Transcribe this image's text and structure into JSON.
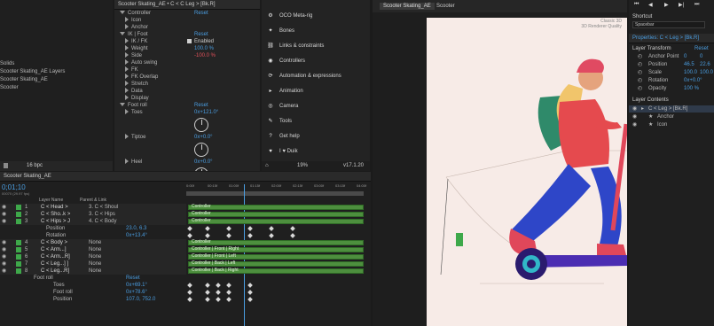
{
  "effect_controls": {
    "title": "Scooter Skating_AE • C < C Leg > [Bk.R]",
    "rows": [
      {
        "label": "Controller",
        "value": "Reset"
      },
      {
        "label": "Icon",
        "value": ""
      },
      {
        "label": "Anchor",
        "value": ""
      },
      {
        "label": "IK | Foot",
        "value": "Reset"
      },
      {
        "label": "IK / FK",
        "value": "Enabled"
      },
      {
        "label": "Weight",
        "value": "100.0 %"
      },
      {
        "label": "Side",
        "value": "-100.0 %"
      },
      {
        "label": "Auto swing",
        "value": ""
      },
      {
        "label": "FK",
        "value": ""
      },
      {
        "label": "FK Overlap",
        "value": ""
      },
      {
        "label": "Stretch",
        "value": ""
      },
      {
        "label": "Data",
        "value": ""
      },
      {
        "label": "Display",
        "value": ""
      },
      {
        "label": "Foot roll",
        "value": "Reset"
      },
      {
        "label": "Toes",
        "value": "0x+121.0°"
      },
      {
        "label": "Tiptoe",
        "value": "0x+0.0°"
      },
      {
        "label": "Heel",
        "value": "0x+0.0°"
      }
    ]
  },
  "project": {
    "items": [
      "Solids",
      "Scooter Skating_AE Layers",
      "Scooter Skating_AE",
      "Scooter"
    ],
    "bpc": "16 bpc"
  },
  "duik": {
    "menu": [
      "OCO Meta-rig",
      "Bones",
      "Links & constraints",
      "Controllers",
      "Automation & expressions",
      "Animation",
      "Camera",
      "Tools",
      "Get help",
      "I ♥ Duik"
    ],
    "percent": "19%",
    "version": "v17.1.20"
  },
  "comp_viewer": {
    "tab": "Scooter Skating_AE",
    "label": "Scooter",
    "renderer": "Classic 3D",
    "quality": "3D Renderer Quality"
  },
  "right_panel": {
    "shortcut_label": "Shortcut",
    "shortcut_value": "Spacebar",
    "properties_title": "Properties: C < Leg > [Bk.R]",
    "layer_transform": "Layer Transform",
    "reset": "Reset",
    "props": [
      {
        "name": "Anchor Point",
        "value": "0",
        "value2": "0"
      },
      {
        "name": "Position",
        "value": "46.5",
        "value2": "22.6"
      },
      {
        "name": "Scale",
        "value": "100.0",
        "value2": "100.0"
      },
      {
        "name": "Rotation",
        "value": "0x+0.0°",
        "value2": ""
      },
      {
        "name": "Opacity",
        "value": "100 %",
        "value2": ""
      }
    ],
    "layer_contents": "Layer Contents",
    "contents": [
      "C < Leg > [Bk.R]",
      "Anchor",
      "Icon"
    ]
  },
  "timeline": {
    "tab": "Scooter Skating_AE",
    "timecode": "0;01;10",
    "fps_info": "00070 (29.97 fps)",
    "col_layer_name": "Layer Name",
    "col_parent": "Parent & Link",
    "ruler": [
      "0:00f",
      "00:15f",
      "01:00f",
      "01:15f",
      "02:00f",
      "02:15f",
      "03:00f",
      "03:15f",
      "04:00f"
    ],
    "layers": [
      {
        "num": "1",
        "name": "C < Head >",
        "parent": "3. C < Shoul",
        "color": "#3ea84a"
      },
      {
        "num": "2",
        "name": "C < Sho..k >",
        "parent": "3. C < Hips",
        "color": "#3ea84a"
      },
      {
        "num": "3",
        "name": "C < Hips > J",
        "parent": "4. C < Body",
        "color": "#3ea84a"
      },
      {
        "num": "",
        "name": "Position",
        "parent": "23.0, 6.3",
        "color": ""
      },
      {
        "num": "",
        "name": "Rotation",
        "parent": "0x+13.4°",
        "color": ""
      },
      {
        "num": "4",
        "name": "C < Body >",
        "parent": "None",
        "color": "#3ea84a"
      },
      {
        "num": "5",
        "name": "C < Arm...]",
        "parent": "None",
        "color": "#3ea84a"
      },
      {
        "num": "6",
        "name": "C < Arm...R]",
        "parent": "None",
        "color": "#3ea84a"
      },
      {
        "num": "7",
        "name": "C < Leg...] ]",
        "parent": "None",
        "color": "#3ea84a"
      },
      {
        "num": "8",
        "name": "C < Leg...R]",
        "parent": "None",
        "color": "#3ea84a"
      }
    ],
    "sub_rows": [
      {
        "name": "Foot roll",
        "value": "Reset"
      },
      {
        "name": "Toes",
        "value": "0x+69.1°"
      },
      {
        "name": "Foot roll",
        "value": "0x+78.6°"
      },
      {
        "name": "Position",
        "value": "107.0, 752.0"
      }
    ],
    "bars": [
      "Controller",
      "Controller",
      "Controller",
      "Controller",
      "Controller | Front | Right",
      "Controller | Front | Left",
      "Controller | Back | Left",
      "Controller | Back | Right"
    ]
  }
}
